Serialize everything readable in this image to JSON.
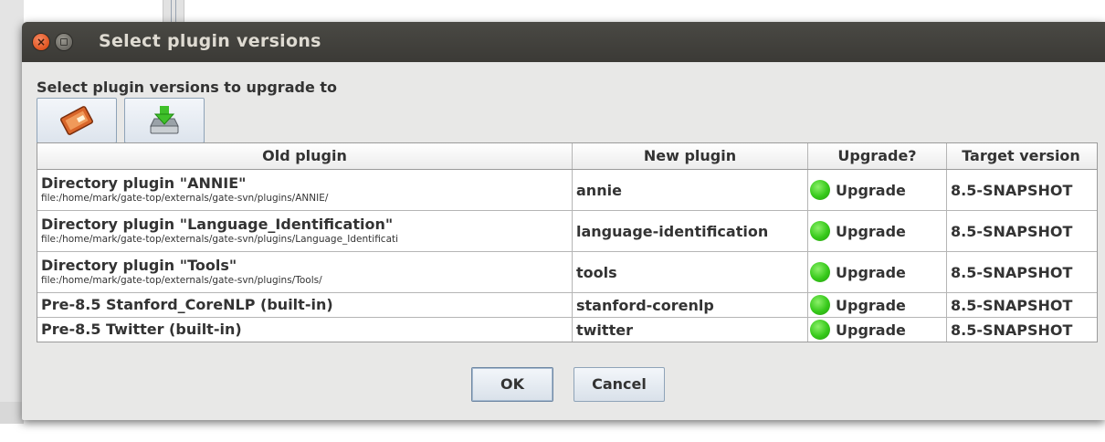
{
  "dialog": {
    "title": "Select plugin versions",
    "subtitle": "Select plugin versions to upgrade to",
    "toolbar": {
      "left_icon": "file-icon",
      "right_icon": "download-icon"
    },
    "table": {
      "headers": [
        "Old plugin",
        "New plugin",
        "Upgrade?",
        "Target version"
      ],
      "rows": [
        {
          "old_name": "Directory plugin \"ANNIE\"",
          "old_path": "file:/home/mark/gate-top/externals/gate-svn/plugins/ANNIE/",
          "new_plugin": "annie",
          "upgrade": "Upgrade",
          "target": "8.5-SNAPSHOT"
        },
        {
          "old_name": "Directory plugin \"Language_Identification\"",
          "old_path": "file:/home/mark/gate-top/externals/gate-svn/plugins/Language_Identificati",
          "new_plugin": "language-identification",
          "upgrade": "Upgrade",
          "target": "8.5-SNAPSHOT"
        },
        {
          "old_name": "Directory plugin \"Tools\"",
          "old_path": "file:/home/mark/gate-top/externals/gate-svn/plugins/Tools/",
          "new_plugin": "tools",
          "upgrade": "Upgrade",
          "target": "8.5-SNAPSHOT"
        },
        {
          "old_name": "Pre-8.5 Stanford_CoreNLP (built-in)",
          "old_path": "",
          "new_plugin": "stanford-corenlp",
          "upgrade": "Upgrade",
          "target": "8.5-SNAPSHOT"
        },
        {
          "old_name": "Pre-8.5 Twitter (built-in)",
          "old_path": "",
          "new_plugin": "twitter",
          "upgrade": "Upgrade",
          "target": "8.5-SNAPSHOT"
        }
      ]
    },
    "buttons": {
      "ok": "OK",
      "cancel": "Cancel"
    },
    "colors": {
      "status_green": "#36c91a",
      "titlebar": "#3b3a36",
      "close_orange": "#e0541f"
    }
  }
}
